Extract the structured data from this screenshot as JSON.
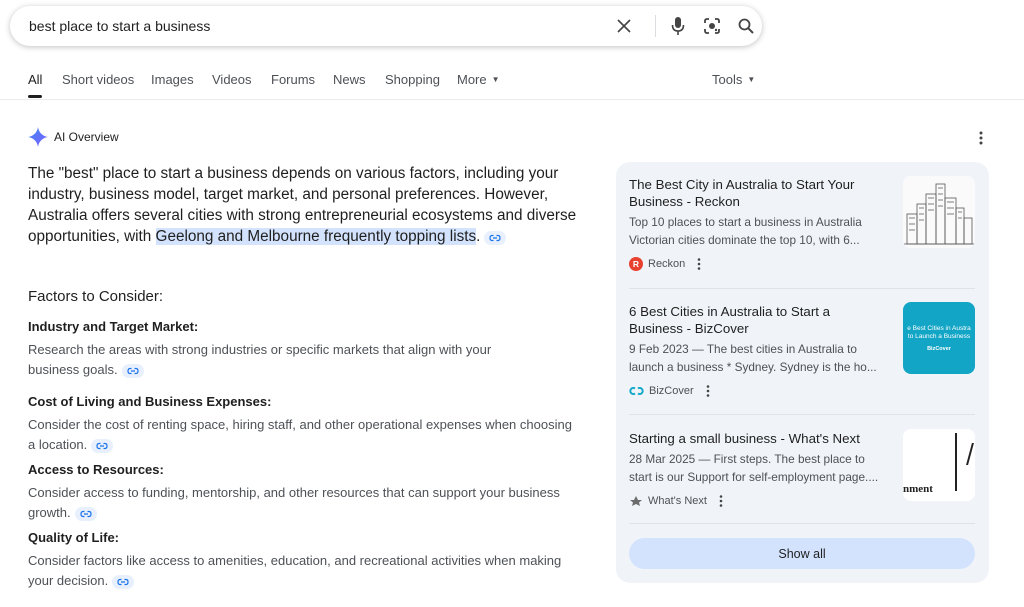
{
  "search": {
    "query": "best place to start a business"
  },
  "tabs": [
    {
      "label": "All"
    },
    {
      "label": "Short videos"
    },
    {
      "label": "Images"
    },
    {
      "label": "Videos"
    },
    {
      "label": "Forums"
    },
    {
      "label": "News"
    },
    {
      "label": "Shopping"
    },
    {
      "label": "More"
    }
  ],
  "tools_label": "Tools",
  "ai_overview": {
    "label": "AI Overview",
    "summary_plain": "The \"best\" place to start a business depends on various factors, including your industry, business model, target market, and personal preferences. However, Australia offers several cities with strong entrepreneurial ecosystems and diverse opportunities, with ",
    "summary_highlight": "Geelong and Melbourne frequently topping lists",
    "summary_end": ".",
    "factors_title": "Factors to Consider:",
    "factors": [
      {
        "title": "Industry and Target Market:",
        "desc": "Research the areas with strong industries or specific markets that align with your business goals."
      },
      {
        "title": "Cost of Living and Business Expenses:",
        "desc": "Consider the cost of renting space, hiring staff, and other operational expenses when choosing a location."
      },
      {
        "title": "Access to Resources:",
        "desc": "Consider access to funding, mentorship, and other resources that can support your business growth."
      },
      {
        "title": "Quality of Life:",
        "desc": "Consider factors like access to amenities, education, and recreational activities when making your decision."
      }
    ]
  },
  "sources": [
    {
      "title": "The Best City in Australia to Start Your Business - Reckon",
      "snippet1": "Top 10 places to start a business in Australia",
      "snippet2": "Victorian cities dominate the top 10, with 6...",
      "site": "Reckon",
      "favicon_letter": "R",
      "favicon_color": "#e8412f"
    },
    {
      "title": "6 Best Cities in Australia to Start a Business - BizCover",
      "snippet1": "9 Feb 2023 — The best cities in Australia to",
      "snippet2": "launch a business * Sydney. Sydney is the ho...",
      "site": "BizCover",
      "thumb_text": "e Best Cities in Austra to Launch a Business",
      "thumb_brand": "BizCover",
      "favicon_color": "#12a9c9"
    },
    {
      "title": "Starting a small business - What's Next",
      "snippet1": "28 Mar 2025 — First steps. The best place to",
      "snippet2": "start is our Support for self-employment page....",
      "site": "What's Next",
      "thumb_text": "nment"
    }
  ],
  "show_all_label": "Show all"
}
